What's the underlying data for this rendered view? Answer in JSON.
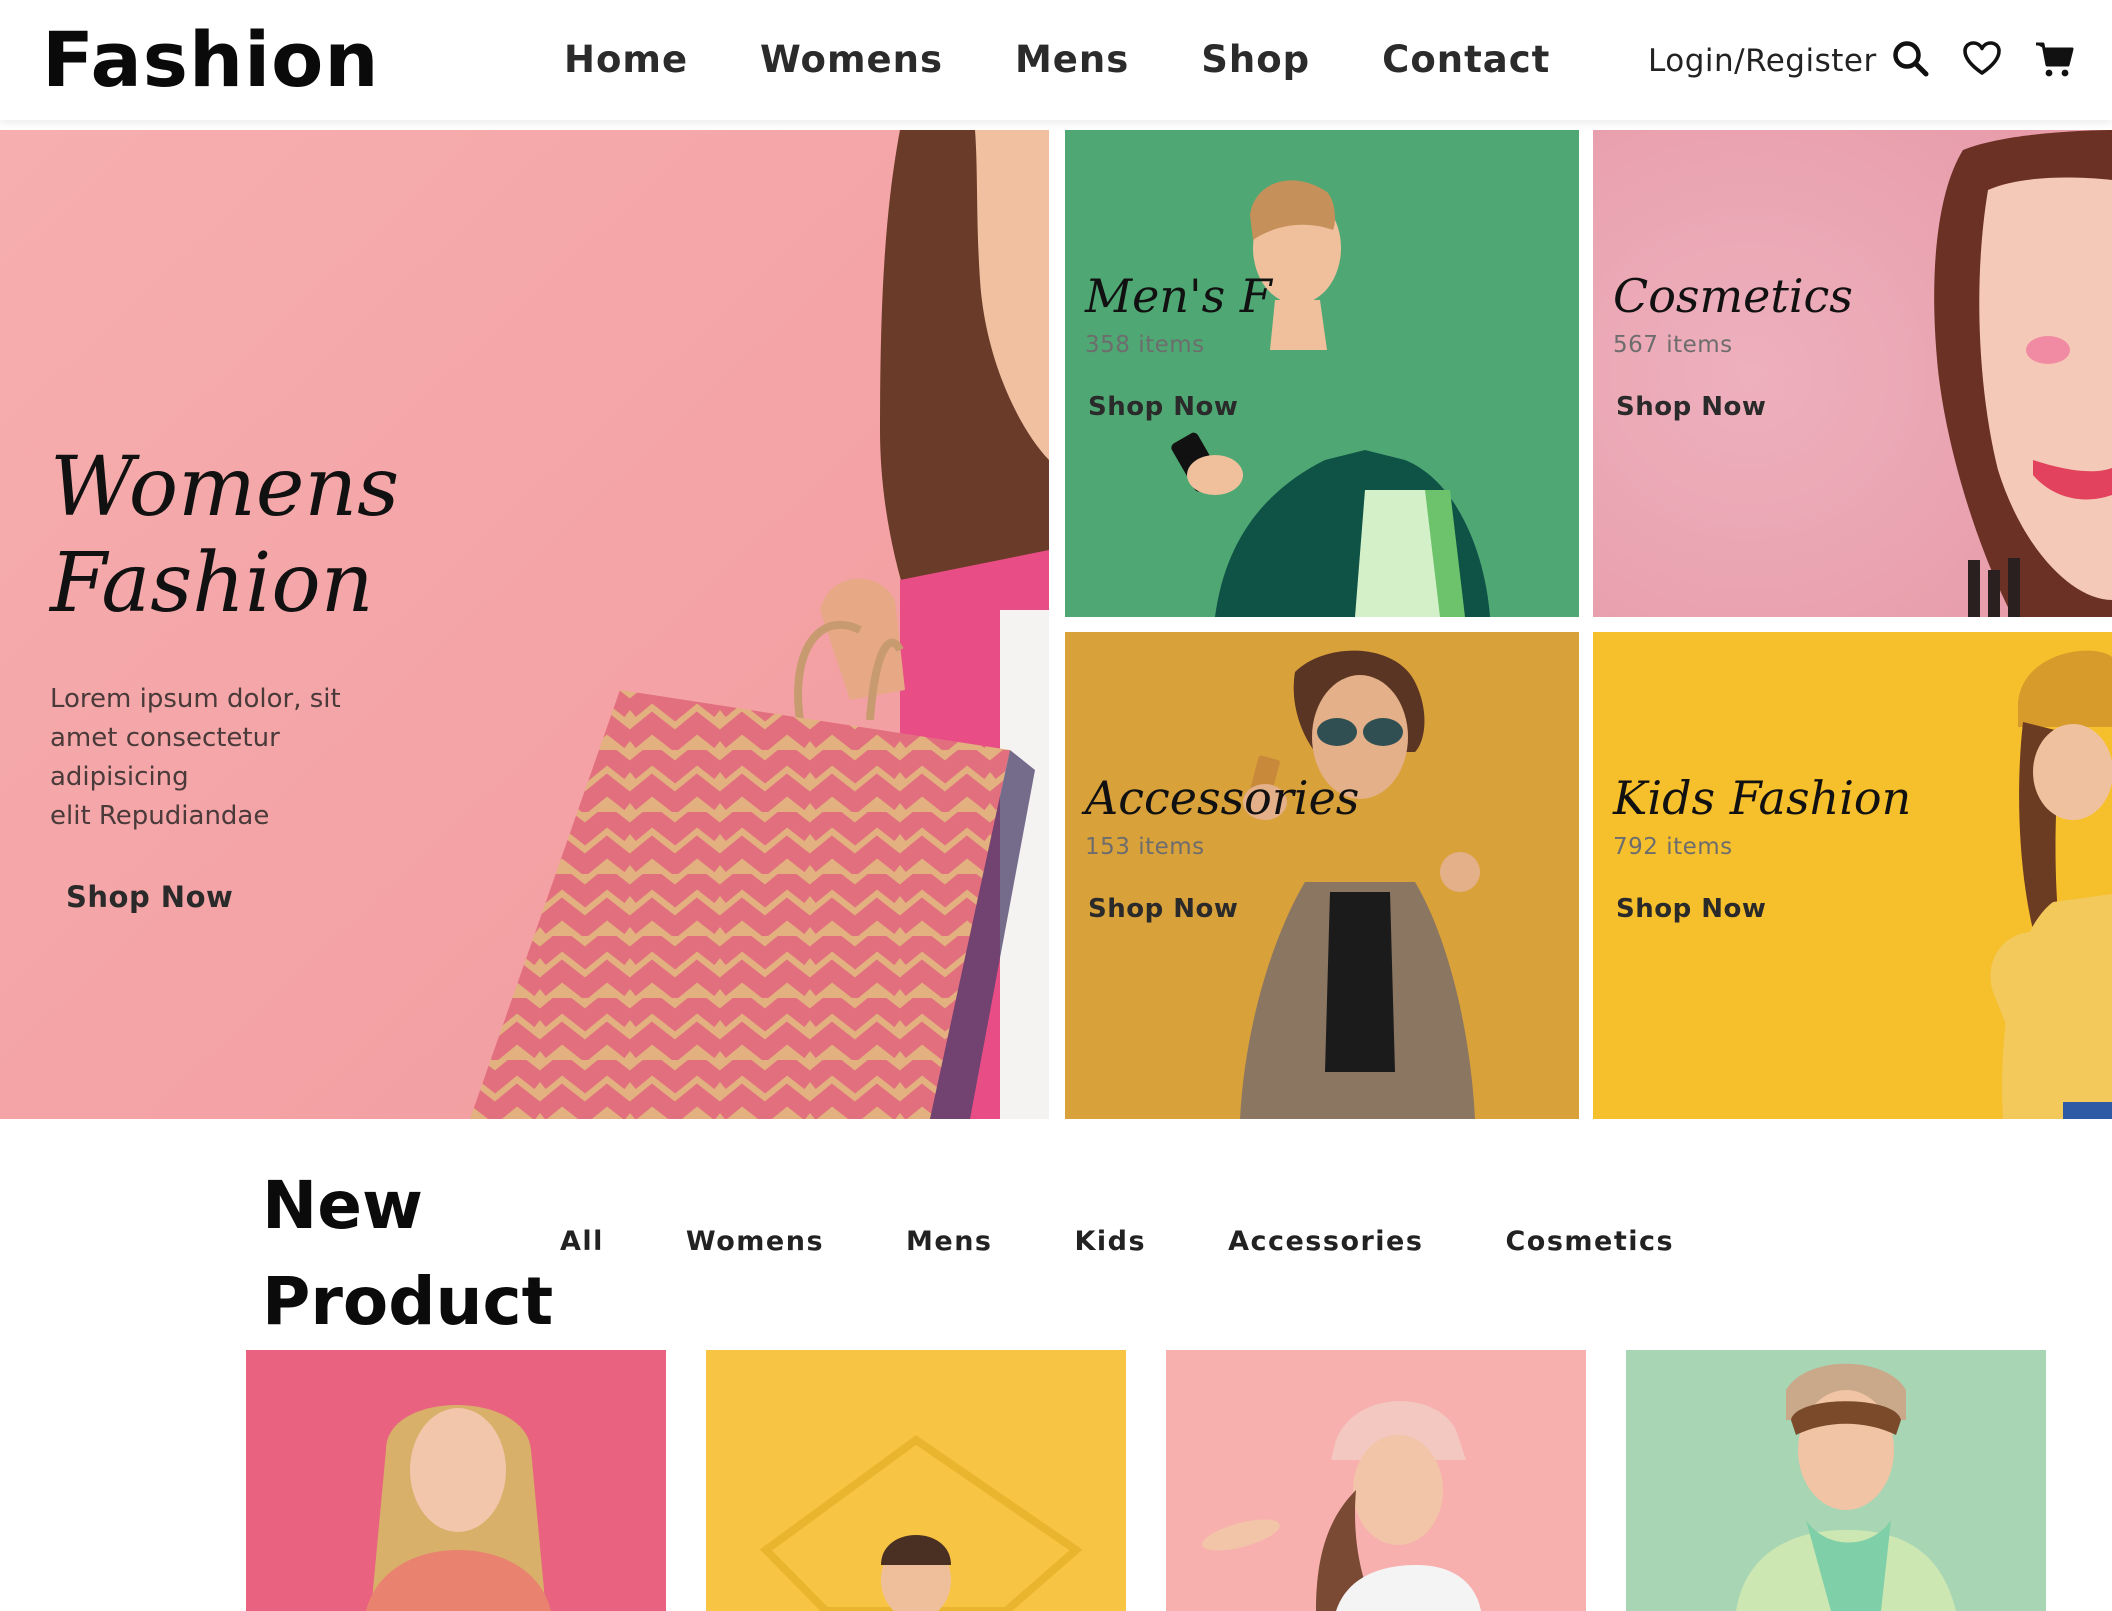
{
  "header": {
    "logo": "Fashion",
    "nav": [
      "Home",
      "Womens",
      "Mens",
      "Shop",
      "Contact"
    ],
    "login_label": "Login/Register",
    "icons": [
      "search-icon",
      "heart-icon",
      "cart-icon"
    ]
  },
  "hero": {
    "main": {
      "title_line1": "Womens",
      "title_line2": "Fashion",
      "description_lines": [
        "Lorem ipsum dolor, sit",
        "amet consectetur",
        "adipisicing",
        "elit Repudiandae"
      ],
      "cta": "Shop Now"
    },
    "tiles": [
      {
        "title": "Men's F",
        "count": "358 items",
        "cta": "Shop Now"
      },
      {
        "title": "Cosmetics",
        "count": "567 items",
        "cta": "Shop Now"
      },
      {
        "title": "Accessories",
        "count": "153 items",
        "cta": "Shop Now"
      },
      {
        "title": "Kids Fashion",
        "count": "792 items",
        "cta": "Shop Now"
      }
    ]
  },
  "new_product": {
    "title_line1": "New",
    "title_line2": "Product",
    "filters": [
      "All",
      "Womens",
      "Mens",
      "Kids",
      "Accessories",
      "Cosmetics"
    ]
  },
  "colors": {
    "hero_pink": "#f4a6a8",
    "mens_green": "#4fa874",
    "cosmetics_pink": "#eaa3b0",
    "accessories_gold": "#d9a13a",
    "kids_yellow": "#f6bf2c"
  }
}
